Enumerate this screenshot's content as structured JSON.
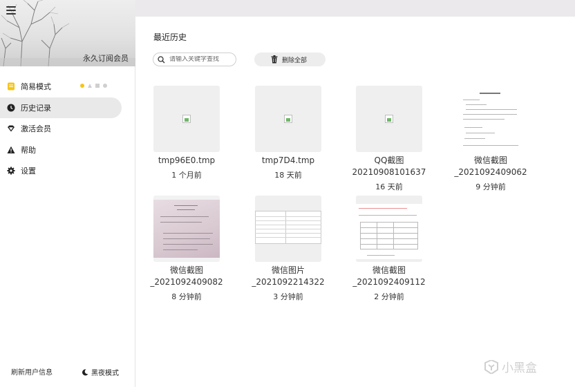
{
  "sidebar": {
    "vip_label": "永久订阅会员",
    "items": [
      {
        "label": "简易模式",
        "icon": "note-icon"
      },
      {
        "label": "历史记录",
        "icon": "clock-icon"
      },
      {
        "label": "激活会员",
        "icon": "diamond-icon"
      },
      {
        "label": "帮助",
        "icon": "warning-icon"
      },
      {
        "label": "设置",
        "icon": "gear-icon"
      }
    ],
    "refresh_user": "刷新用户信息",
    "night_mode": "黑夜模式"
  },
  "main": {
    "title": "最近历史",
    "search_placeholder": "请输入关键字查找",
    "delete_all": "删除全部"
  },
  "files": [
    {
      "name": "tmp96E0.tmp",
      "time": "1 个月前",
      "thumb": "broken"
    },
    {
      "name": "tmp7D4.tmp",
      "time": "18 天前",
      "thumb": "broken"
    },
    {
      "name": "QQ截图",
      "name2": "20210908101637",
      "time": "16 天前",
      "thumb": "broken"
    },
    {
      "name": "微信截图",
      "name2": "_2021092409062",
      "time": "9 分钟前",
      "thumb": "document"
    },
    {
      "name": "微信截图",
      "name2": "_2021092409082",
      "time": "8 分钟前",
      "thumb": "photo"
    },
    {
      "name": "微信图片",
      "name2": "_2021092214322",
      "time": "3 分钟前",
      "thumb": "form"
    },
    {
      "name": "微信截图",
      "name2": "_2021092409112",
      "time": "2 分钟前",
      "thumb": "table"
    }
  ],
  "watermark": "小黑盒",
  "colors": {
    "accent": "#f5c518",
    "active_bg": "#e9e9e9",
    "titlebar": "#ebe9eb"
  }
}
